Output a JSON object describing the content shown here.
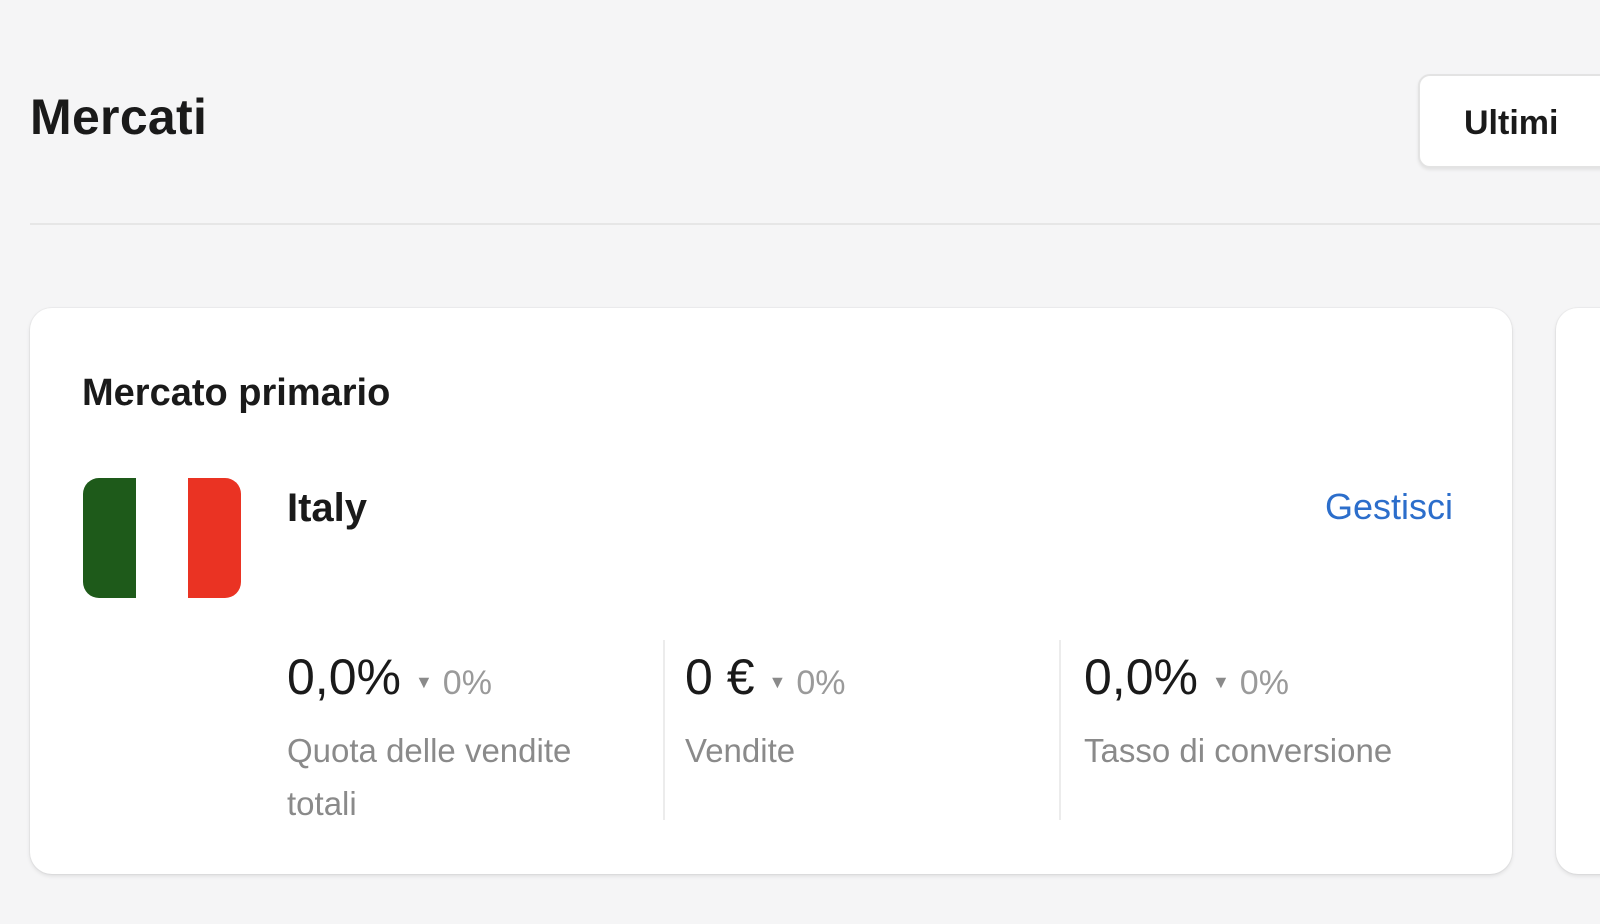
{
  "header": {
    "title": "Mercati",
    "date_button_label": "Ultimi"
  },
  "primary_market": {
    "title": "Mercato primario",
    "country": {
      "name": "Italy",
      "flag_colors": [
        "#1e5a1a",
        "#ffffff",
        "#ea3323"
      ]
    },
    "manage_link": "Gestisci",
    "metrics": [
      {
        "value": "0,0%",
        "change": "0%",
        "trend_icon": "caret-down-icon",
        "label": "Quota delle vendite totali"
      },
      {
        "value": "0 €",
        "change": "0%",
        "trend_icon": "caret-down-icon",
        "label": "Vendite"
      },
      {
        "value": "0,0%",
        "change": "0%",
        "trend_icon": "caret-down-icon",
        "label": "Tasso di conversione"
      }
    ]
  },
  "colors": {
    "background": "#f5f5f6",
    "card": "#ffffff",
    "link": "#2c6ecb",
    "muted_text": "#8a8a8a"
  }
}
